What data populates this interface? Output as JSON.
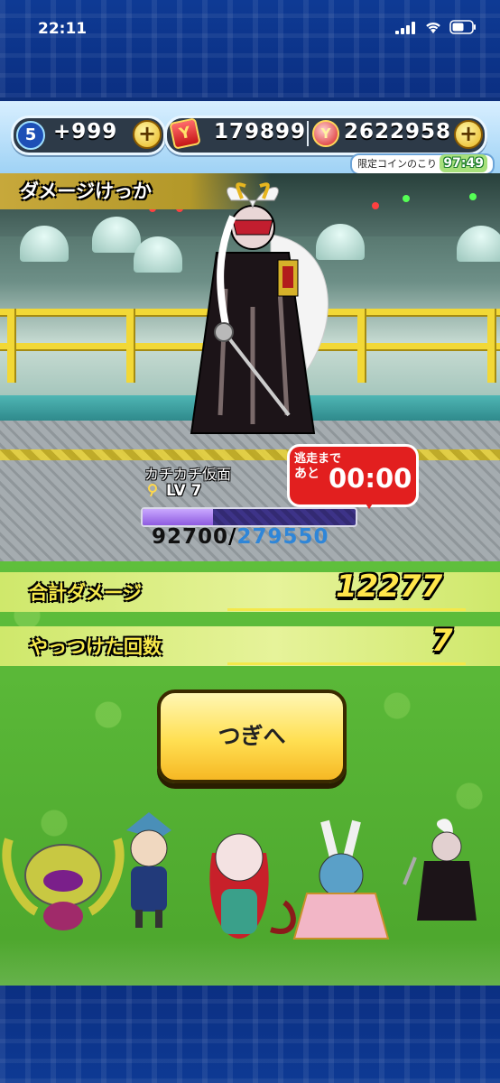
{
  "status_bar": {
    "time": "22:11"
  },
  "currency": {
    "watch_rank": "5",
    "points": "+999",
    "money": "179899",
    "coins": "2622958",
    "limited_coins_label": "限定コインのこり",
    "limited_coins_time": "97:49"
  },
  "result": {
    "title": "ダメージけっか"
  },
  "boss": {
    "name": "カチカチ仮面",
    "level": "LV  7",
    "hp_current": "92700",
    "hp_separator": "/",
    "hp_max": "279550",
    "hp_fraction": 0.332
  },
  "escape": {
    "label_line1": "逃走まで",
    "label_line2": "あと",
    "time": "00:00"
  },
  "stats": {
    "total_damage_label": "合計ダメージ",
    "total_damage_value": "12277",
    "defeat_count_label": "やっつけた回数",
    "defeat_count_value": "7"
  },
  "next_button": {
    "label": "つぎへ"
  },
  "colors": {
    "accent_yellow": "#ffe54a",
    "escape_red": "#e21f1f",
    "hp_blue": "#2f86d8"
  }
}
